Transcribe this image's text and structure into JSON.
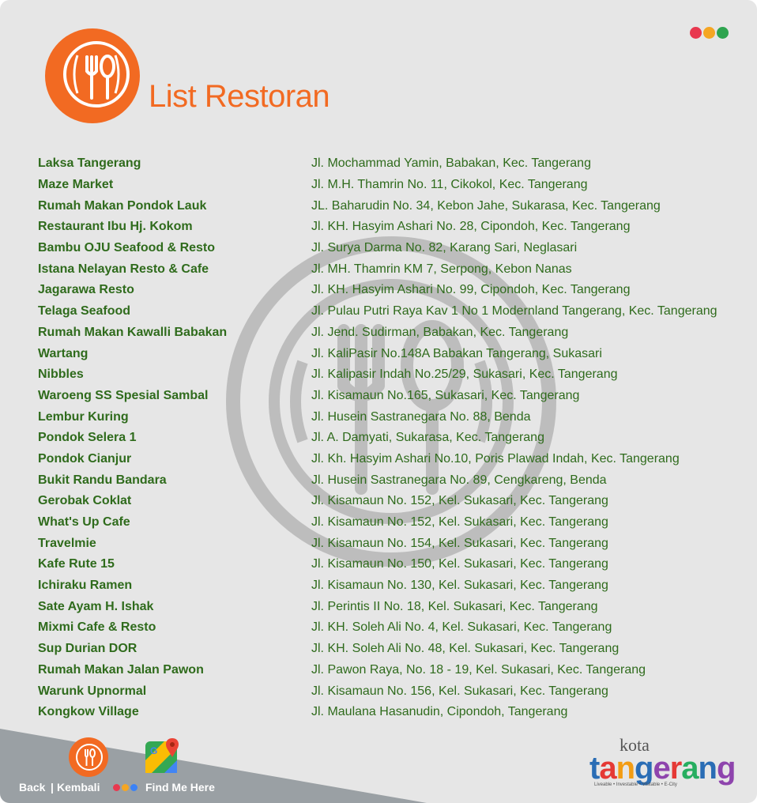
{
  "header": {
    "title": "List Restoran",
    "logo_icon": "fork-spoon-plate-icon",
    "window_dots": [
      "#e8384f",
      "#f5a623",
      "#2ea44f"
    ]
  },
  "colors": {
    "accent": "#f26a22",
    "text_green": "#2f6b1c",
    "panel_bg": "#e6e6e6",
    "footer_bg": "#9aa0a4"
  },
  "restaurants": [
    {
      "name": "Laksa Tangerang",
      "address": "Jl. Mochammad Yamin, Babakan, Kec. Tangerang"
    },
    {
      "name": "Maze Market",
      "address": "Jl. M.H. Thamrin No. 11, Cikokol, Kec. Tangerang"
    },
    {
      "name": "Rumah Makan Pondok Lauk",
      "address": "JL. Baharudin No. 34, Kebon Jahe, Sukarasa, Kec. Tangerang"
    },
    {
      "name": "Restaurant Ibu Hj. Kokom",
      "address": "Jl. KH. Hasyim Ashari No. 28, Cipondoh, Kec. Tangerang"
    },
    {
      "name": "Bambu OJU Seafood & Resto",
      "address": "Jl. Surya Darma No. 82, Karang Sari, Neglasari"
    },
    {
      "name": "Istana Nelayan Resto & Cafe",
      "address": "Jl. MH. Thamrin KM 7, Serpong, Kebon Nanas"
    },
    {
      "name": "Jagarawa Resto",
      "address": "Jl. KH. Hasyim Ashari No. 99, Cipondoh, Kec. Tangerang"
    },
    {
      "name": "Telaga Seafood",
      "address": "Jl. Pulau Putri Raya Kav 1 No 1 Modernland Tangerang, Kec. Tangerang"
    },
    {
      "name": "Rumah Makan Kawalli Babakan",
      "address": "Jl. Jend. Sudirman, Babakan, Kec. Tangerang"
    },
    {
      "name": "Wartang",
      "address": "Jl. KaliPasir No.148A Babakan Tangerang, Sukasari"
    },
    {
      "name": "Nibbles",
      "address": "Jl. Kalipasir Indah No.25/29, Sukasari, Kec. Tangerang"
    },
    {
      "name": "Waroeng SS Spesial Sambal",
      "address": "Jl. Kisamaun No.165, Sukasari, Kec. Tangerang"
    },
    {
      "name": "Lembur Kuring",
      "address": "Jl. Husein Sastranegara No. 88, Benda"
    },
    {
      "name": "Pondok Selera 1",
      "address": "Jl. A. Damyati, Sukarasa, Kec. Tangerang"
    },
    {
      "name": "Pondok Cianjur",
      "address": "Jl. Kh. Hasyim Ashari No.10, Poris Plawad Indah, Kec. Tangerang"
    },
    {
      "name": "Bukit Randu Bandara",
      "address": "Jl. Husein Sastranegara No. 89, Cengkareng, Benda"
    },
    {
      "name": "Gerobak Coklat",
      "address": "Jl. Kisamaun No. 152, Kel. Sukasari, Kec. Tangerang"
    },
    {
      "name": "What's Up Cafe",
      "address": "Jl. Kisamaun No. 152, Kel. Sukasari, Kec. Tangerang"
    },
    {
      "name": "Travelmie",
      "address": "Jl. Kisamaun No. 154, Kel. Sukasari, Kec. Tangerang"
    },
    {
      "name": "Kafe Rute 15",
      "address": "Jl. Kisamaun No. 150, Kel. Sukasari, Kec. Tangerang"
    },
    {
      "name": "Ichiraku Ramen",
      "address": "Jl. Kisamaun No. 130, Kel. Sukasari, Kec. Tangerang"
    },
    {
      "name": "Sate Ayam H. Ishak",
      "address": "Jl. Perintis II No. 18, Kel. Sukasari, Kec. Tangerang"
    },
    {
      "name": "Mixmi Cafe & Resto",
      "address": "Jl. KH. Soleh Ali No. 4, Kel. Sukasari, Kec. Tangerang"
    },
    {
      "name": "Sup Durian DOR",
      "address": "Jl. KH. Soleh Ali No. 48,  Kel. Sukasari, Kec. Tangerang"
    },
    {
      "name": "Rumah Makan Jalan Pawon",
      "address": "Jl. Pawon Raya, No. 18 - 19, Kel. Sukasari, Kec. Tangerang"
    },
    {
      "name": "Warunk Upnormal",
      "address": "Jl. Kisamaun No. 156, Kel. Sukasari, Kec. Tangerang"
    },
    {
      "name": "Kongkow Village",
      "address": "Jl. Maulana Hasanudin, Cipondoh, Tangerang"
    }
  ],
  "footer": {
    "back_label": "Back",
    "kembali_label": "Kembali",
    "find_me_label": "Find Me Here",
    "nav_dots": [
      "#e8384f",
      "#f5a623",
      "#3b82f6"
    ],
    "brand_kota": "kota",
    "brand_letters": [
      "t",
      "a",
      "n",
      "g",
      "e",
      "r",
      "a",
      "n",
      "g"
    ],
    "brand_colors": [
      "#2a6db5",
      "#e53935",
      "#f39c12",
      "#2a6db5",
      "#8e44ad",
      "#e53935",
      "#27ae60",
      "#2a6db5",
      "#8e44ad"
    ],
    "brand_tagline": "Liveable • Investable • Visitable • E-City"
  }
}
